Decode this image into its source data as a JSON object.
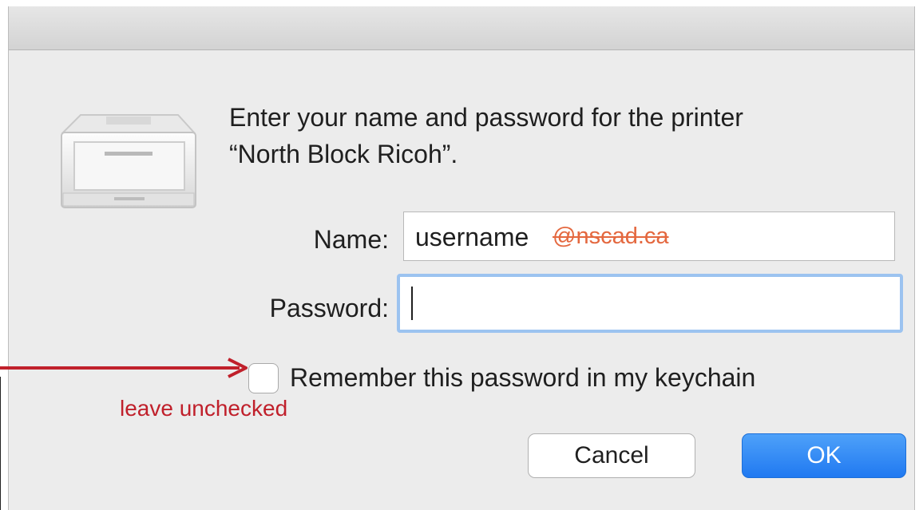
{
  "dialog": {
    "message_line1": "Enter your name and password for the printer",
    "message_line2": "“North Block Ricoh”.",
    "name_label": "Name:",
    "name_value": "username",
    "name_suffix_struck": "@nscad.ca",
    "password_label": "Password:",
    "password_value": "",
    "remember_label": "Remember this password in my keychain",
    "remember_checked": false,
    "cancel_label": "Cancel",
    "ok_label": "OK",
    "icon": "printer-icon"
  },
  "annotation": {
    "note": "leave unchecked",
    "color": "#c0202b"
  },
  "colors": {
    "dialog_bg": "#ececec",
    "ok_button": "#2f86f5",
    "focus_ring": "#9cc3f0",
    "struck_text": "#e4683f"
  }
}
